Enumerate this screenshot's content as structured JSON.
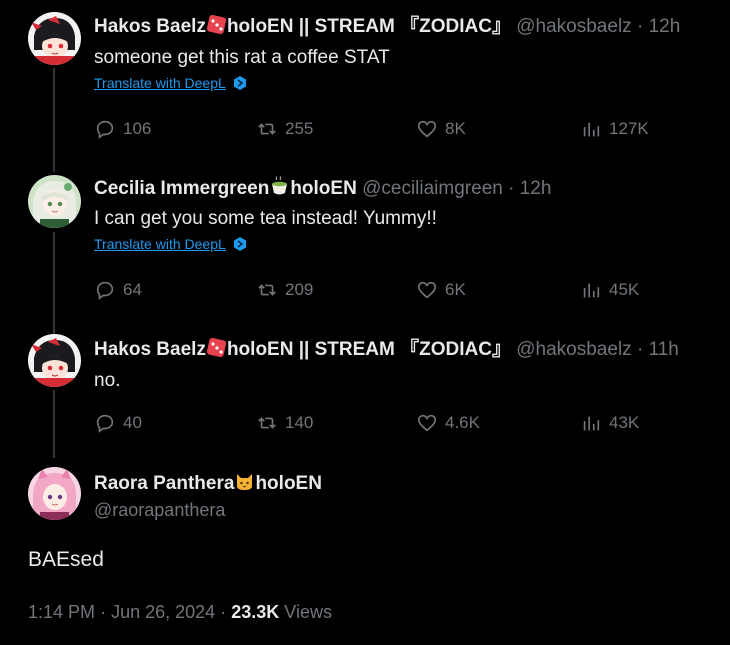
{
  "tweets": [
    {
      "name": "Hakos Baelz",
      "name_suffix": "holoEN || STREAM 『ZODIAC』",
      "emoji": "dice-emoji",
      "handle": "@hakosbaelz",
      "time": "12h",
      "text": "someone get this rat a coffee STAT",
      "translate": "Translate with DeepL",
      "replies": "106",
      "retweets": "255",
      "likes": "8K",
      "views": "127K"
    },
    {
      "name": "Cecilia Immergreen",
      "name_suffix": "holoEN",
      "emoji": "tea-emoji",
      "handle": "@ceciliaimgreen",
      "time": "12h",
      "text": "I can get you some tea instead! Yummy!!",
      "translate": "Translate with DeepL",
      "replies": "64",
      "retweets": "209",
      "likes": "6K",
      "views": "45K"
    },
    {
      "name": "Hakos Baelz",
      "name_suffix": "holoEN || STREAM 『ZODIAC』",
      "emoji": "dice-emoji",
      "handle": "@hakosbaelz",
      "time": "11h",
      "text": "no.",
      "replies": "40",
      "retweets": "140",
      "likes": "4.6K",
      "views": "43K"
    }
  ],
  "main_tweet": {
    "name": "Raora Panthera",
    "name_suffix": "holoEN",
    "emoji": "cat-emoji",
    "handle": "@raorapanthera",
    "text": "BAEsed",
    "time": "1:14 PM",
    "date": "Jun 26, 2024",
    "views_count": "23.3K",
    "views_label": "Views",
    "separator": "·"
  },
  "colors": {
    "background": "#000000",
    "text": "#e7e9ea",
    "muted": "#71767b",
    "link": "#1d9bf0",
    "thread_line": "#333639"
  }
}
